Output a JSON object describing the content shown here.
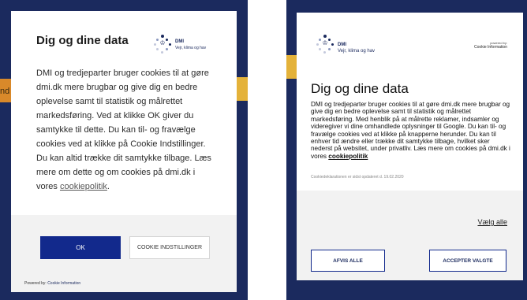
{
  "left": {
    "title": "Dig og dine data",
    "logo": {
      "name": "DMI",
      "tagline": "Vejr, klima og hav"
    },
    "body_before_link": "DMI og tredjeparter bruger cookies til at gøre dmi.dk mere brugbar og give dig en bedre oplevelse samt til statistik og målrettet markedsføring. Ved at klikke OK giver du samtykke til dette. Du kan til- og fravælge cookies ved at klikke på Cookie Indstillinger. Du kan altid trække dit samtykke tilbage. Læs mere om dette og om cookies på dmi.dk i vores ",
    "link_text": "cookiepolitik",
    "body_after_link": ".",
    "ok_button": "OK",
    "settings_button": "COOKIE INDSTILLINGER",
    "powered_by_prefix": "Powered by: ",
    "powered_by_link": "Cookie Information",
    "background_fragment": "nd"
  },
  "right": {
    "logo": {
      "name": "DMI",
      "tagline": "Vejr, klima og hav"
    },
    "powered_by_small": "powered by:",
    "powered_by_brand": "Cookie Information",
    "title": "Dig og dine data",
    "body_before_link": "DMI og tredjeparter bruger cookies til at gøre dmi.dk mere brugbar og give dig en bedre oplevelse samt til statistik og målrettet markedsføring. Med henblik på at målrette reklamer, indsamler og videregiver vi dine omhandlede oplysninger til Google. Du kan til- og fravælge cookies ved at klikke på knapperne herunder. Du kan til enhver tid ændre eller trække dit samtykke tilbage, hvilket sker nederst på websitet, under privatliv. Læs mere om cookies på dmi.dk i vores ",
    "link_text": "cookiepolitik",
    "updated_text": "Cookiedeklarationen er sidst opdateret d. 19.02.2020",
    "select_all": "Vælg alle",
    "reject_button": "AFVIS ALLE",
    "accept_button": "ACCEPTER VALGTE"
  },
  "colors": {
    "navy": "#1b2a5e",
    "button_blue": "#12298c",
    "backdrop_yellow": "#e4b23a",
    "backdrop_orange": "#d9892a",
    "footer_grey": "#f2f2f2"
  }
}
